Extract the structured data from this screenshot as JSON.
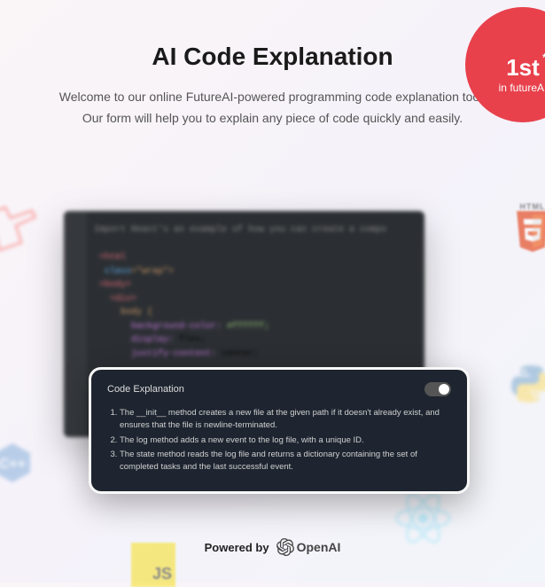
{
  "badge": {
    "rank": "1st",
    "sub": "in futureAI"
  },
  "header": {
    "title": "AI Code Explanation",
    "subtitle": "Welcome to our online FutureAI-powered programming code explanation tool. Our form will help you to explain any piece of code quickly and easily."
  },
  "panel": {
    "title": "Code Explanation",
    "items": [
      "The __init__ method creates a new file at the given path if it doesn't already exist, and ensures that the file is newline-terminated.",
      "The log method adds a new event to the log file, with a unique ID.",
      "The state method reads the log file and returns a dictionary containing the set of completed tasks and the last successful event."
    ]
  },
  "footer": {
    "powered": "Powered by",
    "brand": "OpenAI"
  },
  "icons": {
    "html5": "HTML",
    "js": "JS"
  }
}
